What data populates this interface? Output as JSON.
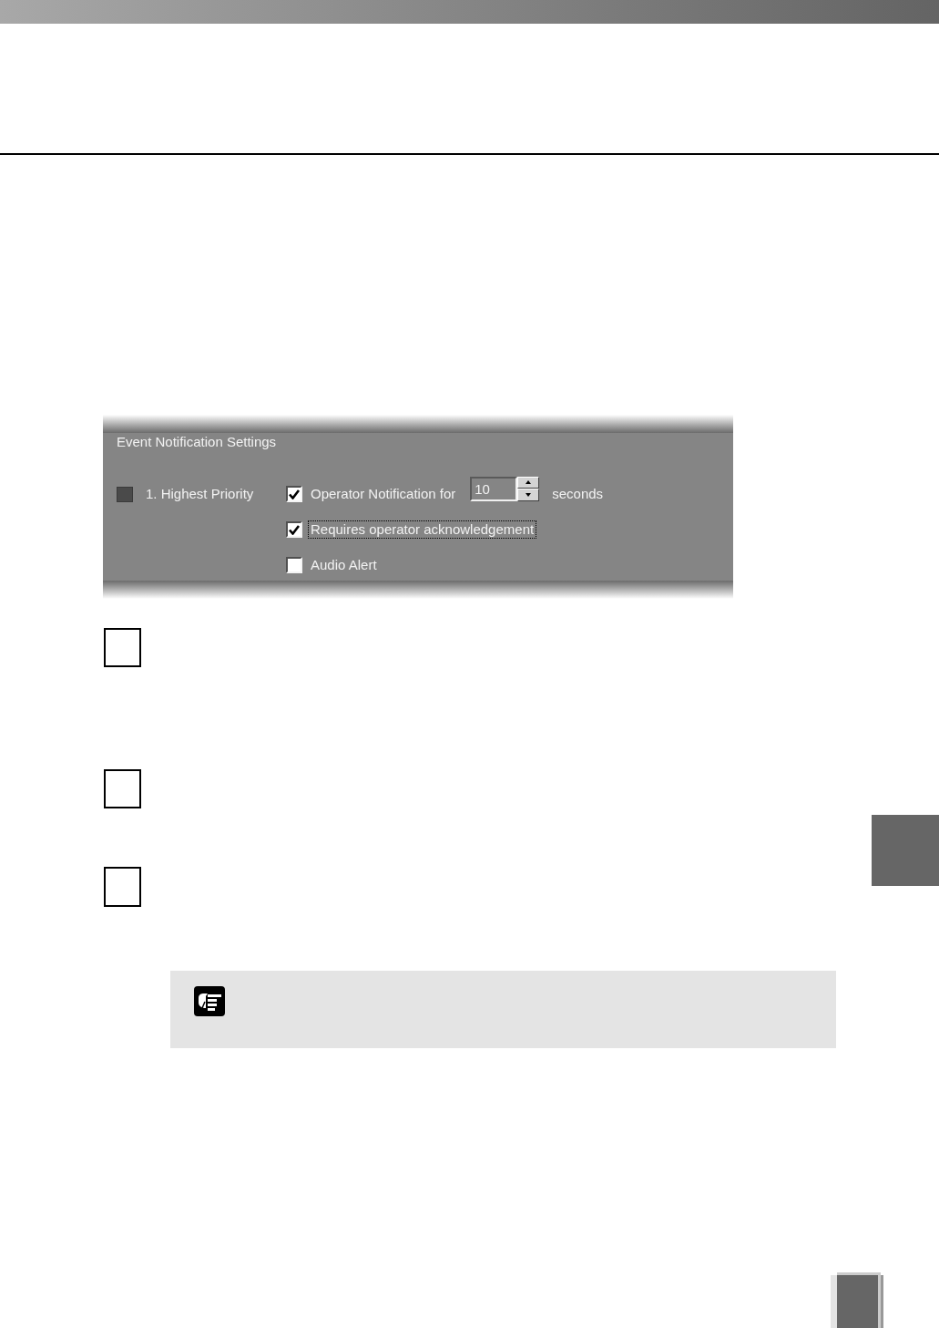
{
  "panel": {
    "title": "Event Notification Settings",
    "priorities": [
      {
        "label": "1. Highest Priority",
        "color": "#4a4a4a",
        "options": [
          {
            "kind": "duration",
            "label": "Operator Notification for",
            "checked": true,
            "focused": false,
            "value": "10",
            "unit": "seconds"
          },
          {
            "kind": "check",
            "label": "Requires operator acknowledgement",
            "checked": true,
            "focused": true
          },
          {
            "kind": "check",
            "label": "Audio Alert",
            "checked": false,
            "focused": false
          }
        ]
      }
    ]
  }
}
